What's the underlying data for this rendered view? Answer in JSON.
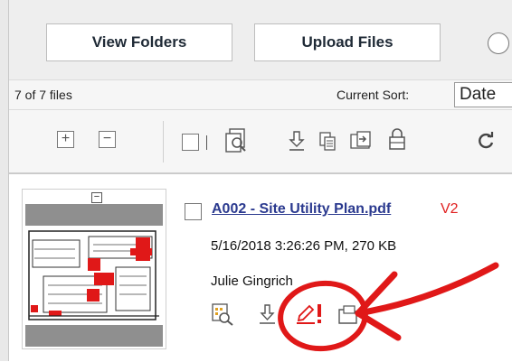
{
  "toolbar": {
    "view_folders_label": "View Folders",
    "upload_files_label": "Upload Files"
  },
  "status": {
    "file_count": "7 of 7 files",
    "sort_label": "Current Sort:",
    "sort_value": "Date"
  },
  "file": {
    "name": "A002 - Site Utility Plan.pdf",
    "version": "V2",
    "meta": "5/16/2018 3:26:26 PM, 270 KB",
    "author": "Julie Gingrich"
  },
  "colors": {
    "accent_red": "#e01818",
    "link_blue": "#2b3a8f",
    "version_red": "#e02020"
  },
  "icons": {
    "toolbar": [
      "expand-all-icon",
      "collapse-all-icon",
      "select-all-checkbox",
      "search-document-icon",
      "download-icon",
      "copy-icon",
      "move-to-folder-icon",
      "lock-icon",
      "refresh-icon"
    ],
    "file_actions": [
      "preview-icon",
      "download-icon",
      "edit-with-alert-icon",
      "folder-icon"
    ]
  }
}
